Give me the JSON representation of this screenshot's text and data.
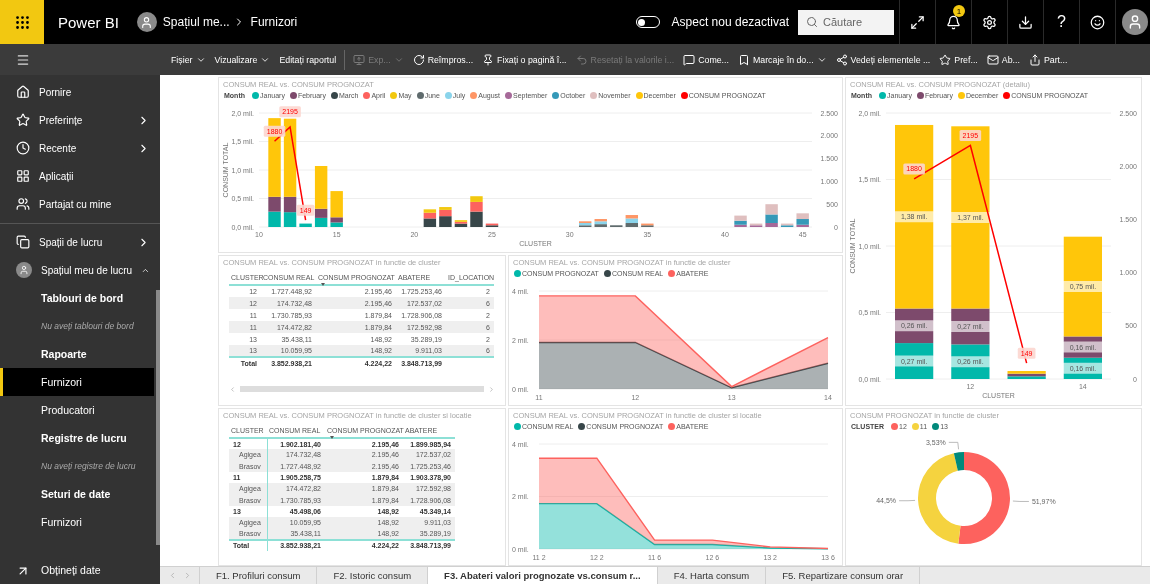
{
  "top_bar": {
    "app_name": "Power BI",
    "breadcrumb": [
      "Spațiul me...",
      "Furnizori"
    ],
    "new_look_toggle": {
      "on": false,
      "label": "Aspect nou dezactivat"
    },
    "search": {
      "placeholder": "Căutare"
    },
    "notification_count": "1",
    "help": "?"
  },
  "toolbar": {
    "items": [
      {
        "label": "Fișier",
        "caret": true,
        "disabled": false
      },
      {
        "label": "Vizualizare",
        "caret": true,
        "disabled": false
      },
      {
        "label": "Editați raportul",
        "caret": false,
        "disabled": false
      },
      {
        "label": "Exp...",
        "caret": true,
        "disabled": true
      },
      {
        "label": "Reîmpros...",
        "caret": false,
        "disabled": false
      },
      {
        "label": "Fixați o pagină î...",
        "caret": false,
        "disabled": false
      },
      {
        "label": "Resetați la valorile i...",
        "caret": false,
        "disabled": true
      },
      {
        "label": "Come...",
        "caret": false,
        "disabled": false
      },
      {
        "label": "Marcaje în do...",
        "caret": true,
        "disabled": false
      },
      {
        "label": "Vedeți elementele ...",
        "caret": false,
        "disabled": false
      },
      {
        "label": "Pref...",
        "caret": false,
        "disabled": false
      },
      {
        "label": "Ab...",
        "caret": false,
        "disabled": false
      },
      {
        "label": "Part...",
        "caret": false,
        "disabled": false
      }
    ]
  },
  "sidebar": {
    "items": [
      {
        "kind": "link",
        "label": "Pornire"
      },
      {
        "kind": "folder",
        "label": "Preferințe",
        "expanded": false
      },
      {
        "kind": "folder",
        "label": "Recente",
        "expanded": false
      },
      {
        "kind": "link",
        "label": "Aplicații"
      },
      {
        "kind": "link",
        "label": "Partajat cu mine"
      },
      {
        "kind": "folder",
        "label": "Spații de lucru",
        "expanded": false
      },
      {
        "kind": "folder",
        "label": "Spațiul meu de lucru",
        "expanded": true,
        "children": [
          {
            "kind": "heading",
            "label": "Tablouri de bord"
          },
          {
            "kind": "note",
            "label": "Nu aveți tablouri de bord"
          },
          {
            "kind": "heading",
            "label": "Rapoarte"
          },
          {
            "kind": "report",
            "label": "Furnizori",
            "selected": true
          },
          {
            "kind": "report",
            "label": "Producatori",
            "selected": false
          },
          {
            "kind": "heading",
            "label": "Registre de lucru"
          },
          {
            "kind": "note",
            "label": "Nu aveți registre de lucru"
          },
          {
            "kind": "heading",
            "label": "Seturi de date"
          },
          {
            "kind": "report",
            "label": "Furnizori",
            "selected": false
          }
        ]
      }
    ],
    "footer": {
      "label": "Obțineți date"
    }
  },
  "visuals": [
    {
      "kind": "chart",
      "title": "CONSUM REAL vs. CONSUM PROGNOZAT",
      "legend_title": "Month",
      "chart_data": {
        "type": "bar",
        "stacked": true,
        "legend": "top",
        "grid": true,
        "xlabel": "CLUSTER",
        "ylabel": "CONSUM TOTAL",
        "x": [
          11,
          12,
          13,
          14,
          15,
          21,
          22,
          23,
          24,
          25,
          31,
          32,
          33,
          34,
          35,
          41,
          42,
          43,
          44,
          45
        ],
        "xlim": [
          10,
          45.6
        ],
        "xticks": [
          10,
          15,
          20,
          25,
          30,
          35,
          40,
          45
        ],
        "ylim": [
          0,
          2
        ],
        "yticks": [
          {
            "value": 0,
            "label": "0,0 mil."
          },
          {
            "value": 0.5,
            "label": "0,5 mil."
          },
          {
            "value": 1,
            "label": "1,0 mil."
          },
          {
            "value": 1.5,
            "label": "1,5 mil."
          },
          {
            "value": 2,
            "label": "2,0 mil."
          }
        ],
        "y2lim": [
          0,
          2500
        ],
        "y2ticks": [
          {
            "value": 0,
            "label": "0"
          },
          {
            "value": 500,
            "label": "500"
          },
          {
            "value": 1000,
            "label": "1.000"
          },
          {
            "value": 1500,
            "label": "1.500"
          },
          {
            "value": 2000,
            "label": "2.000"
          },
          {
            "value": 2500,
            "label": "2.500"
          }
        ],
        "series": [
          {
            "name": "January",
            "color": "#01B8AA",
            "values": [
              0.27,
              0.26,
              0.06,
              0.16,
              0.08,
              0,
              0,
              0,
              0,
              0,
              0,
              0,
              0,
              0,
              0,
              0,
              0,
              0,
              0,
              0
            ]
          },
          {
            "name": "February",
            "color": "#7D4A6C",
            "values": [
              0.26,
              0.27,
              0,
              0.16,
              0.09,
              0,
              0,
              0,
              0,
              0,
              0,
              0,
              0,
              0,
              0,
              0,
              0,
              0,
              0,
              0
            ]
          },
          {
            "name": "March",
            "color": "#374649",
            "values": [
              0,
              0,
              0,
              0,
              0,
              0.15,
              0.19,
              0.06,
              0.27,
              0.03,
              0,
              0,
              0,
              0,
              0,
              0,
              0,
              0,
              0,
              0
            ]
          },
          {
            "name": "April",
            "color": "#FD625E",
            "values": [
              0,
              0,
              0,
              0,
              0,
              0.1,
              0.11,
              0.03,
              0.17,
              0.03,
              0,
              0,
              0,
              0,
              0,
              0,
              0,
              0,
              0,
              0
            ]
          },
          {
            "name": "May",
            "color": "#F2C80F",
            "values": [
              0,
              0,
              0,
              0,
              0,
              0.06,
              0.05,
              0.03,
              0.1,
              0,
              0,
              0,
              0,
              0,
              0,
              0,
              0,
              0,
              0,
              0
            ]
          },
          {
            "name": "June",
            "color": "#5F6B6D",
            "values": [
              0,
              0,
              0,
              0,
              0,
              0,
              0,
              0,
              0,
              0,
              0.03,
              0.05,
              0.03,
              0.07,
              0.03,
              0,
              0,
              0,
              0,
              0
            ]
          },
          {
            "name": "July",
            "color": "#8AD4EB",
            "values": [
              0,
              0,
              0,
              0,
              0,
              0,
              0,
              0,
              0,
              0,
              0.04,
              0.05,
              0,
              0.08,
              0,
              0,
              0,
              0,
              0,
              0
            ]
          },
          {
            "name": "August",
            "color": "#FE9666",
            "values": [
              0,
              0,
              0,
              0,
              0,
              0,
              0,
              0,
              0,
              0,
              0.03,
              0.04,
              0,
              0.06,
              0.03,
              0,
              0,
              0,
              0,
              0
            ]
          },
          {
            "name": "September",
            "color": "#A66999",
            "values": [
              0,
              0,
              0,
              0,
              0,
              0,
              0,
              0,
              0,
              0,
              0,
              0,
              0,
              0,
              0,
              0.04,
              0.03,
              0.07,
              0,
              0.04
            ]
          },
          {
            "name": "October",
            "color": "#3599B8",
            "values": [
              0,
              0,
              0,
              0,
              0,
              0,
              0,
              0,
              0,
              0,
              0,
              0,
              0,
              0,
              0,
              0.07,
              0,
              0.15,
              0.03,
              0.1
            ]
          },
          {
            "name": "November",
            "color": "#DFBFBF",
            "values": [
              0,
              0,
              0,
              0,
              0,
              0,
              0,
              0,
              0,
              0,
              0,
              0,
              0,
              0,
              0,
              0.09,
              0.03,
              0.18,
              0.03,
              0.1
            ]
          },
          {
            "name": "December",
            "color": "#FFC60A",
            "values": [
              1.38,
              1.37,
              0,
              0.75,
              0.46,
              0,
              0,
              0,
              0,
              0,
              0,
              0,
              0,
              0,
              0,
              0,
              0,
              0,
              0,
              0
            ]
          },
          {
            "name": "CONSUM PROGNOZAT",
            "color": "#FF0000",
            "type": "line",
            "axis": "y2",
            "values": [
              1880,
              2195,
              149,
              null,
              null,
              null,
              null,
              null,
              null,
              null,
              null,
              null,
              null,
              null,
              null,
              null,
              null,
              null,
              null,
              null
            ]
          }
        ],
        "value_labels": [
          null,
          null,
          null,
          null,
          null,
          null,
          null,
          null,
          null,
          null,
          null,
          null,
          [
            "1880",
            "2195",
            "149",
            null,
            null,
            null,
            null,
            null,
            null,
            null,
            null,
            null,
            null,
            null,
            null,
            null,
            null,
            null,
            null,
            null
          ]
        ]
      }
    },
    {
      "kind": "chart",
      "title": "CONSUM REAL vs. CONSUM PROGNOZAT (detaliu)",
      "legend_title": "Month",
      "chart_data": {
        "type": "bar",
        "stacked": true,
        "legend": "top",
        "grid": true,
        "xlabel": "CLUSTER",
        "ylabel": "CONSUM TOTAL",
        "x": [
          11,
          12,
          13,
          14
        ],
        "xlim": [
          10.5,
          14.5
        ],
        "xticks": [
          12,
          14
        ],
        "ylim": [
          0,
          2
        ],
        "yticks": [
          {
            "value": 0,
            "label": "0,0 mil."
          },
          {
            "value": 0.5,
            "label": "0,5 mil."
          },
          {
            "value": 1,
            "label": "1,0 mil."
          },
          {
            "value": 1.5,
            "label": "1,5 mil."
          },
          {
            "value": 2,
            "label": "2,0 mil."
          }
        ],
        "y2lim": [
          0,
          2500
        ],
        "y2ticks": [
          {
            "value": 0,
            "label": "0"
          },
          {
            "value": 500,
            "label": "500"
          },
          {
            "value": 1000,
            "label": "1.000"
          },
          {
            "value": 1500,
            "label": "1.500"
          },
          {
            "value": 2000,
            "label": "2.000"
          },
          {
            "value": 2500,
            "label": "2.500"
          }
        ],
        "series": [
          {
            "name": "January",
            "color": "#01B8AA",
            "values": [
              0.27,
              0.26,
              0.02,
              0.16
            ]
          },
          {
            "name": "February",
            "color": "#7D4A6C",
            "values": [
              0.26,
              0.27,
              0.02,
              0.16
            ]
          },
          {
            "name": "December",
            "color": "#FFC60A",
            "values": [
              1.38,
              1.37,
              0.02,
              0.75
            ]
          },
          {
            "name": "CONSUM PROGNOZAT",
            "color": "#FF0000",
            "type": "line",
            "axis": "y2",
            "values": [
              1880,
              2195,
              149,
              null
            ]
          }
        ],
        "value_labels": [
          [
            "0,27 mil.",
            "0,26 mil.",
            null,
            "0,16 mil."
          ],
          [
            "0,26 mil.",
            "0,27 mil.",
            null,
            "0,16 mil."
          ],
          [
            "1,38 mil.",
            "1,37 mil.",
            null,
            "0,75 mil."
          ],
          [
            "1880",
            "2195",
            "149",
            null
          ]
        ]
      }
    },
    {
      "kind": "table",
      "title": "CONSUM REAL vs. CONSUM PROGNOZAT in functie de cluster",
      "columns": [
        {
          "label": "CLUSTER",
          "sorted": false
        },
        {
          "label": "CONSUM REAL",
          "sorted": false
        },
        {
          "label": "CONSUM PROGNOZAT",
          "sorted": true
        },
        {
          "label": "ABATERE",
          "sorted": false
        },
        {
          "label": "ID_LOCATION",
          "sorted": false
        }
      ],
      "rows": [
        [
          "12",
          "1.727.448,92",
          "2.195,46",
          "1.725.253,46",
          "2"
        ],
        [
          "12",
          "174.732,48",
          "2.195,46",
          "172.537,02",
          "6"
        ],
        [
          "11",
          "1.730.785,93",
          "1.879,84",
          "1.728.906,08",
          "2"
        ],
        [
          "11",
          "174.472,82",
          "1.879,84",
          "172.592,98",
          "6"
        ],
        [
          "13",
          "35.438,11",
          "148,92",
          "35.289,19",
          "2"
        ],
        [
          "13",
          "10.059,95",
          "148,92",
          "9.911,03",
          "6"
        ]
      ],
      "total": [
        "Total",
        "3.852.938,21",
        "4.224,22",
        "3.848.713,99"
      ]
    },
    {
      "kind": "chart",
      "title": "CONSUM REAL vs. CONSUM PROGNOZAT in functie de cluster",
      "chart_data": {
        "type": "area",
        "stacked": true,
        "legend": "top",
        "grid": true,
        "categories": [
          "11",
          "12",
          "13",
          "14"
        ],
        "ylim": [
          0,
          4
        ],
        "yticks": [
          {
            "value": 0,
            "label": "0 mil."
          },
          {
            "value": 2,
            "label": "2 mil."
          },
          {
            "value": 4,
            "label": "4 mil."
          }
        ],
        "series": [
          {
            "name": "CONSUM PROGNOZAT",
            "color": "#01B8AA",
            "values": [
              null,
              null,
              null,
              null
            ]
          },
          {
            "name": "CONSUM REAL",
            "color": "#374649",
            "values": [
              1.9,
              1.9,
              0.05,
              1.05
            ]
          },
          {
            "name": "ABATERE",
            "color": "#FD625E",
            "values": [
              1.9,
              1.9,
              0.05,
              1.05
            ]
          }
        ]
      }
    },
    {
      "kind": "matrix",
      "title": "CONSUM REAL vs. CONSUM PROGNOZAT in functie de cluster si locatie",
      "columns": [
        {
          "label": "CLUSTER",
          "sorted": false
        },
        {
          "label": "CONSUM REAL",
          "sorted": false
        },
        {
          "label": "CONSUM PROGNOZAT",
          "sorted": true
        },
        {
          "label": "ABATERE",
          "sorted": false
        }
      ],
      "rows": [
        {
          "kind": "group",
          "cells": [
            "12",
            "1.902.181,40",
            "2.195,46",
            "1.899.985,94"
          ]
        },
        {
          "kind": "child",
          "cells": [
            "Agigea",
            "174.732,48",
            "2.195,46",
            "172.537,02"
          ]
        },
        {
          "kind": "child",
          "cells": [
            "Brasov",
            "1.727.448,92",
            "2.195,46",
            "1.725.253,46"
          ]
        },
        {
          "kind": "group",
          "cells": [
            "11",
            "1.905.258,75",
            "1.879,84",
            "1.903.378,90"
          ]
        },
        {
          "kind": "child",
          "cells": [
            "Agigea",
            "174.472,82",
            "1.879,84",
            "172.592,98"
          ]
        },
        {
          "kind": "child",
          "cells": [
            "Brasov",
            "1.730.785,93",
            "1.879,84",
            "1.728.906,08"
          ]
        },
        {
          "kind": "group",
          "cells": [
            "13",
            "45.498,06",
            "148,92",
            "45.349,14"
          ]
        },
        {
          "kind": "child",
          "cells": [
            "Agigea",
            "10.059,95",
            "148,92",
            "9.911,03"
          ]
        },
        {
          "kind": "child",
          "cells": [
            "Brasov",
            "35.438,11",
            "148,92",
            "35.289,19"
          ]
        }
      ],
      "total": [
        "Total",
        "3.852.938,21",
        "4.224,22",
        "3.848.713,99"
      ]
    },
    {
      "kind": "chart",
      "title": "CONSUM REAL vs. CONSUM PROGNOZAT in functie de cluster si locatie",
      "chart_data": {
        "type": "area",
        "stacked": true,
        "legend": "top",
        "grid": true,
        "categories": [
          "11 2",
          "12 2",
          "11 6",
          "12 6",
          "13 2",
          "13 6"
        ],
        "ylim": [
          0,
          4
        ],
        "yticks": [
          {
            "value": 0,
            "label": "0 mil."
          },
          {
            "value": 2,
            "label": "2 mil."
          },
          {
            "value": 4,
            "label": "4 mil."
          }
        ],
        "series": [
          {
            "name": "CONSUM REAL",
            "color": "#01B8AA",
            "values": [
              1.73,
              1.73,
              0.17,
              0.17,
              0.04,
              0.01
            ]
          },
          {
            "name": "CONSUM PROGNOZAT",
            "color": "#374649",
            "values": [
              null,
              null,
              null,
              null,
              null,
              null
            ]
          },
          {
            "name": "ABATERE",
            "color": "#FD625E",
            "values": [
              1.73,
              1.73,
              0.17,
              0.17,
              0.04,
              0.01
            ]
          }
        ]
      }
    },
    {
      "kind": "chart",
      "title": "CONSUM PROGNOZAT in functie de cluster",
      "legend_title": "CLUSTER",
      "chart_data": {
        "type": "donut",
        "legend": "top",
        "categories": [
          "12",
          "11",
          "13"
        ],
        "values": [
          51.97,
          44.5,
          3.53
        ],
        "colors": [
          "#FD625E",
          "#F5D33F",
          "#01897B"
        ],
        "value_labels": [
          "51,97%",
          "44,5%",
          "3,53%"
        ]
      }
    }
  ],
  "page_tabs": [
    {
      "label": "F1. Profiluri consum",
      "selected": false
    },
    {
      "label": "F2. Istoric consum",
      "selected": false
    },
    {
      "label": "F3. Abateri valori prognozate vs.consum r...",
      "selected": true
    },
    {
      "label": "F4. Harta consum",
      "selected": false
    },
    {
      "label": "F5. Repartizare consum orar",
      "selected": false
    }
  ]
}
